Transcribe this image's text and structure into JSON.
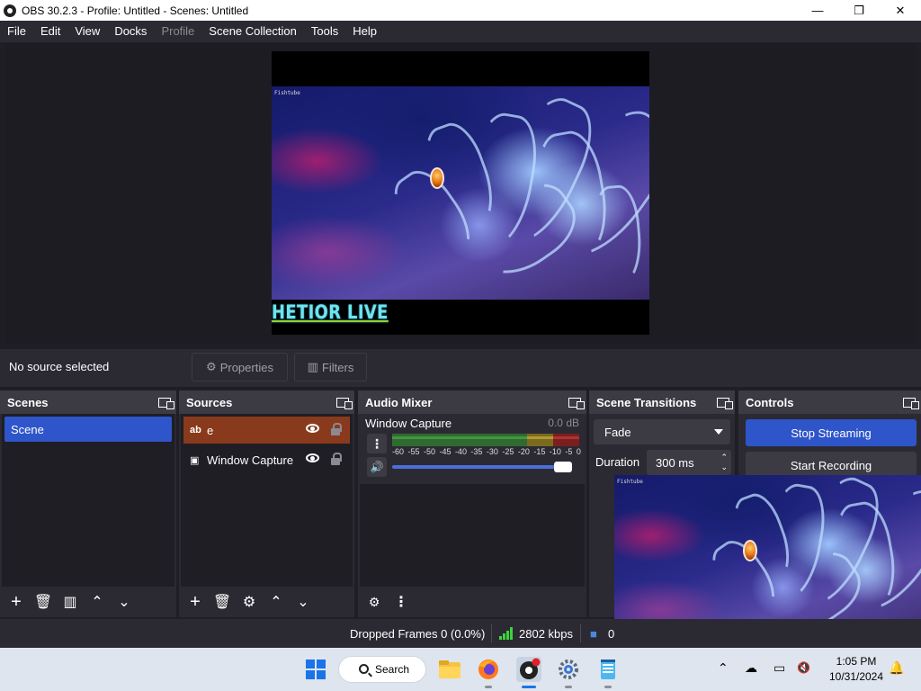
{
  "window": {
    "title": "OBS 30.2.3 - Profile: Untitled - Scenes: Untitled",
    "minimize": "—",
    "maximize": "❐",
    "close": "✕"
  },
  "menu": [
    "File",
    "Edit",
    "View",
    "Docks",
    "Profile",
    "Scene Collection",
    "Tools",
    "Help"
  ],
  "preview": {
    "overlay_text": "HETIOR LIVE",
    "watermark": "Fishtube"
  },
  "source_toolbar": {
    "status": "No source selected",
    "properties": "Properties",
    "filters": "Filters"
  },
  "scenes": {
    "title": "Scenes",
    "items": [
      "Scene"
    ]
  },
  "sources": {
    "title": "Sources",
    "items": [
      {
        "icon": "ab",
        "name": "e"
      },
      {
        "icon": "window",
        "name": "Window Capture"
      }
    ]
  },
  "audio_mixer": {
    "title": "Audio Mixer",
    "channel": "Window Capture",
    "db": "0.0 dB",
    "scale": [
      "-60",
      "-55",
      "-50",
      "-45",
      "-40",
      "-35",
      "-30",
      "-25",
      "-20",
      "-15",
      "-10",
      "-5",
      "0"
    ],
    "volume": 1.0
  },
  "transitions": {
    "title": "Scene Transitions",
    "selected": "Fade",
    "duration_label": "Duration",
    "duration_value": "300 ms"
  },
  "controls": {
    "title": "Controls",
    "stop_streaming": "Stop Streaming",
    "start_recording": "Start Recording"
  },
  "status": {
    "dropped_frames": "Dropped Frames 0 (0.0%)",
    "bitrate": "2802 kbps",
    "extra": "0"
  },
  "taskbar": {
    "search": "Search",
    "time": "1:05 PM",
    "date": "10/31/2024"
  },
  "colors": {
    "accent": "#2e55c9",
    "selected_source": "#8a3a1c",
    "panel": "#2b2a33",
    "background": "#1f1e25"
  }
}
